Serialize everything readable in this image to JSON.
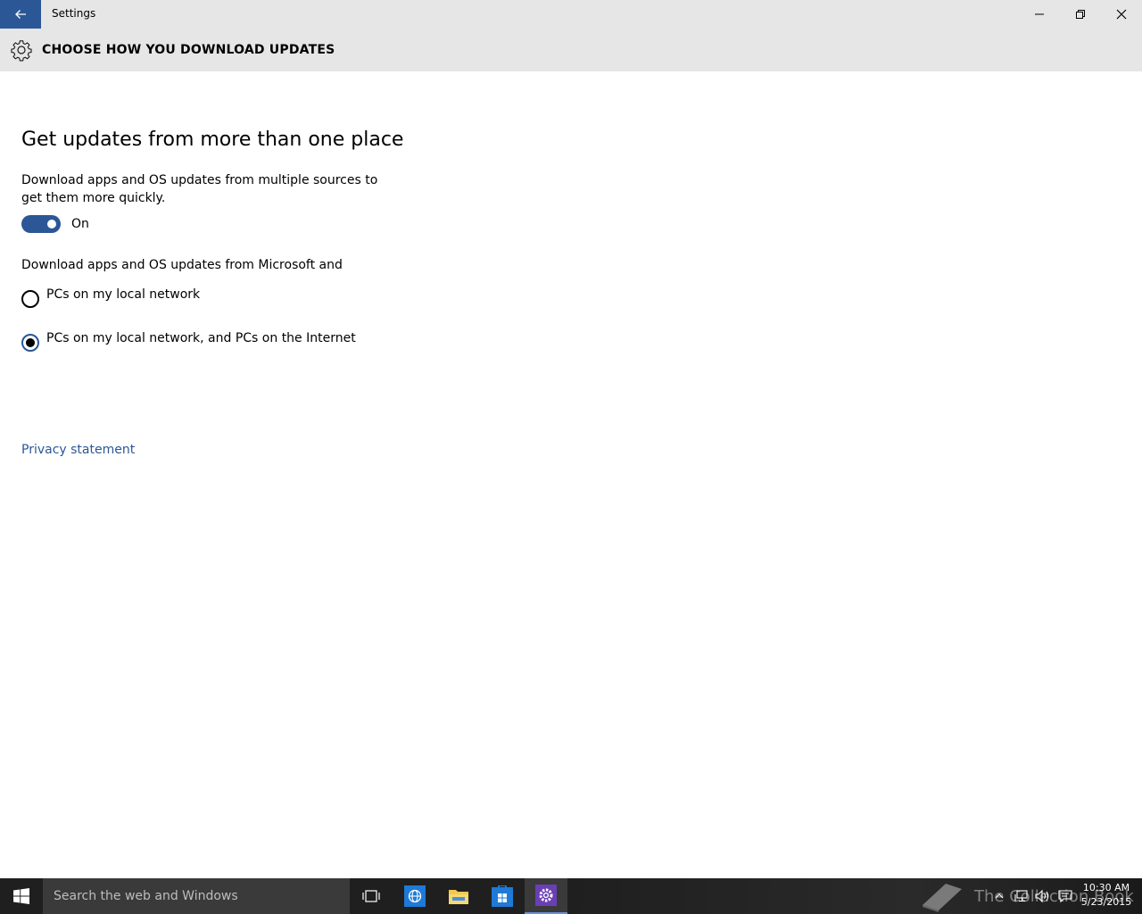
{
  "window": {
    "title": "Settings",
    "icons": {
      "back": "back-arrow-icon",
      "minimize": "minimize-icon",
      "maximize": "restore-icon",
      "close": "close-icon"
    }
  },
  "header": {
    "title": "CHOOSE HOW YOU DOWNLOAD UPDATES",
    "icon": "gear-icon"
  },
  "main": {
    "heading": "Get updates from more than one place",
    "description": "Download apps and OS updates from multiple sources to get them more quickly.",
    "toggle": {
      "state_label": "On",
      "on": true
    },
    "radio_group_label": "Download apps and OS updates from Microsoft and",
    "radio_options": [
      {
        "label": "PCs on my local network",
        "selected": false
      },
      {
        "label": "PCs on my local network, and PCs on the Internet",
        "selected": true
      }
    ],
    "privacy_link": "Privacy statement"
  },
  "taskbar": {
    "search_placeholder": "Search the web and Windows",
    "pinned": [
      "task-view-icon",
      "internet-explorer-icon",
      "file-explorer-icon",
      "store-icon",
      "settings-icon"
    ],
    "active_app": "settings-icon",
    "watermark_text": "The Collection Book",
    "clock": {
      "time": "10:30 AM",
      "date": "5/23/2015"
    }
  },
  "colors": {
    "accent": "#2b5797",
    "titlebar_bg": "#e6e6e6",
    "taskbar_bg": "#1f1f1f"
  }
}
